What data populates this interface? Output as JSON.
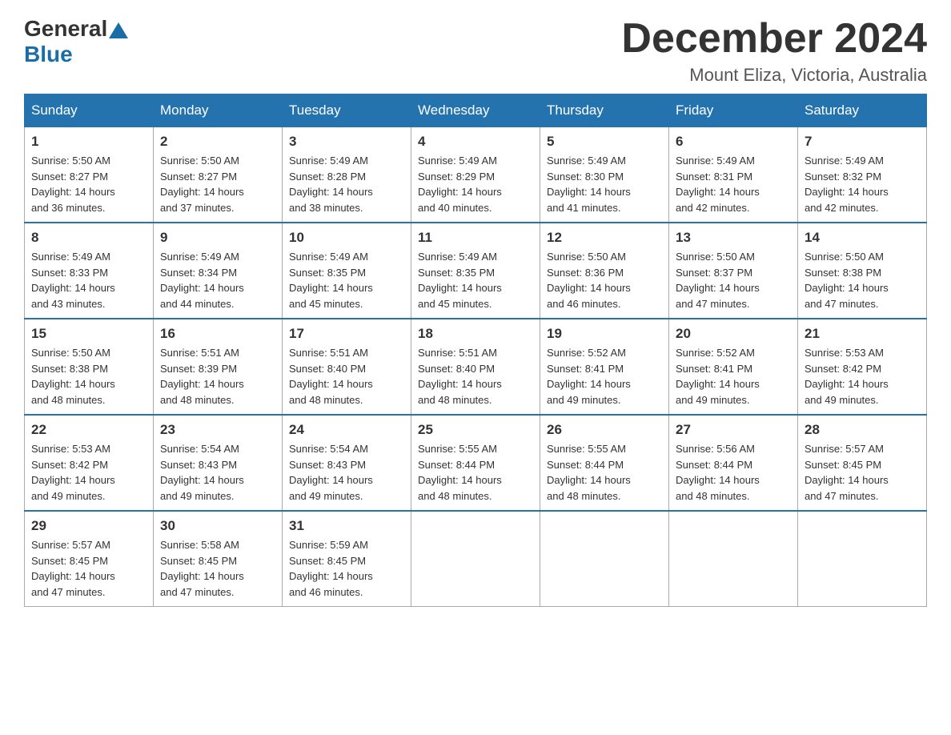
{
  "logo": {
    "general": "General",
    "blue": "Blue"
  },
  "title": "December 2024",
  "location": "Mount Eliza, Victoria, Australia",
  "days_of_week": [
    "Sunday",
    "Monday",
    "Tuesday",
    "Wednesday",
    "Thursday",
    "Friday",
    "Saturday"
  ],
  "weeks": [
    [
      {
        "day": "1",
        "sunrise": "5:50 AM",
        "sunset": "8:27 PM",
        "daylight": "14 hours and 36 minutes."
      },
      {
        "day": "2",
        "sunrise": "5:50 AM",
        "sunset": "8:27 PM",
        "daylight": "14 hours and 37 minutes."
      },
      {
        "day": "3",
        "sunrise": "5:49 AM",
        "sunset": "8:28 PM",
        "daylight": "14 hours and 38 minutes."
      },
      {
        "day": "4",
        "sunrise": "5:49 AM",
        "sunset": "8:29 PM",
        "daylight": "14 hours and 40 minutes."
      },
      {
        "day": "5",
        "sunrise": "5:49 AM",
        "sunset": "8:30 PM",
        "daylight": "14 hours and 41 minutes."
      },
      {
        "day": "6",
        "sunrise": "5:49 AM",
        "sunset": "8:31 PM",
        "daylight": "14 hours and 42 minutes."
      },
      {
        "day": "7",
        "sunrise": "5:49 AM",
        "sunset": "8:32 PM",
        "daylight": "14 hours and 42 minutes."
      }
    ],
    [
      {
        "day": "8",
        "sunrise": "5:49 AM",
        "sunset": "8:33 PM",
        "daylight": "14 hours and 43 minutes."
      },
      {
        "day": "9",
        "sunrise": "5:49 AM",
        "sunset": "8:34 PM",
        "daylight": "14 hours and 44 minutes."
      },
      {
        "day": "10",
        "sunrise": "5:49 AM",
        "sunset": "8:35 PM",
        "daylight": "14 hours and 45 minutes."
      },
      {
        "day": "11",
        "sunrise": "5:49 AM",
        "sunset": "8:35 PM",
        "daylight": "14 hours and 45 minutes."
      },
      {
        "day": "12",
        "sunrise": "5:50 AM",
        "sunset": "8:36 PM",
        "daylight": "14 hours and 46 minutes."
      },
      {
        "day": "13",
        "sunrise": "5:50 AM",
        "sunset": "8:37 PM",
        "daylight": "14 hours and 47 minutes."
      },
      {
        "day": "14",
        "sunrise": "5:50 AM",
        "sunset": "8:38 PM",
        "daylight": "14 hours and 47 minutes."
      }
    ],
    [
      {
        "day": "15",
        "sunrise": "5:50 AM",
        "sunset": "8:38 PM",
        "daylight": "14 hours and 48 minutes."
      },
      {
        "day": "16",
        "sunrise": "5:51 AM",
        "sunset": "8:39 PM",
        "daylight": "14 hours and 48 minutes."
      },
      {
        "day": "17",
        "sunrise": "5:51 AM",
        "sunset": "8:40 PM",
        "daylight": "14 hours and 48 minutes."
      },
      {
        "day": "18",
        "sunrise": "5:51 AM",
        "sunset": "8:40 PM",
        "daylight": "14 hours and 48 minutes."
      },
      {
        "day": "19",
        "sunrise": "5:52 AM",
        "sunset": "8:41 PM",
        "daylight": "14 hours and 49 minutes."
      },
      {
        "day": "20",
        "sunrise": "5:52 AM",
        "sunset": "8:41 PM",
        "daylight": "14 hours and 49 minutes."
      },
      {
        "day": "21",
        "sunrise": "5:53 AM",
        "sunset": "8:42 PM",
        "daylight": "14 hours and 49 minutes."
      }
    ],
    [
      {
        "day": "22",
        "sunrise": "5:53 AM",
        "sunset": "8:42 PM",
        "daylight": "14 hours and 49 minutes."
      },
      {
        "day": "23",
        "sunrise": "5:54 AM",
        "sunset": "8:43 PM",
        "daylight": "14 hours and 49 minutes."
      },
      {
        "day": "24",
        "sunrise": "5:54 AM",
        "sunset": "8:43 PM",
        "daylight": "14 hours and 49 minutes."
      },
      {
        "day": "25",
        "sunrise": "5:55 AM",
        "sunset": "8:44 PM",
        "daylight": "14 hours and 48 minutes."
      },
      {
        "day": "26",
        "sunrise": "5:55 AM",
        "sunset": "8:44 PM",
        "daylight": "14 hours and 48 minutes."
      },
      {
        "day": "27",
        "sunrise": "5:56 AM",
        "sunset": "8:44 PM",
        "daylight": "14 hours and 48 minutes."
      },
      {
        "day": "28",
        "sunrise": "5:57 AM",
        "sunset": "8:45 PM",
        "daylight": "14 hours and 47 minutes."
      }
    ],
    [
      {
        "day": "29",
        "sunrise": "5:57 AM",
        "sunset": "8:45 PM",
        "daylight": "14 hours and 47 minutes."
      },
      {
        "day": "30",
        "sunrise": "5:58 AM",
        "sunset": "8:45 PM",
        "daylight": "14 hours and 47 minutes."
      },
      {
        "day": "31",
        "sunrise": "5:59 AM",
        "sunset": "8:45 PM",
        "daylight": "14 hours and 46 minutes."
      },
      null,
      null,
      null,
      null
    ]
  ]
}
